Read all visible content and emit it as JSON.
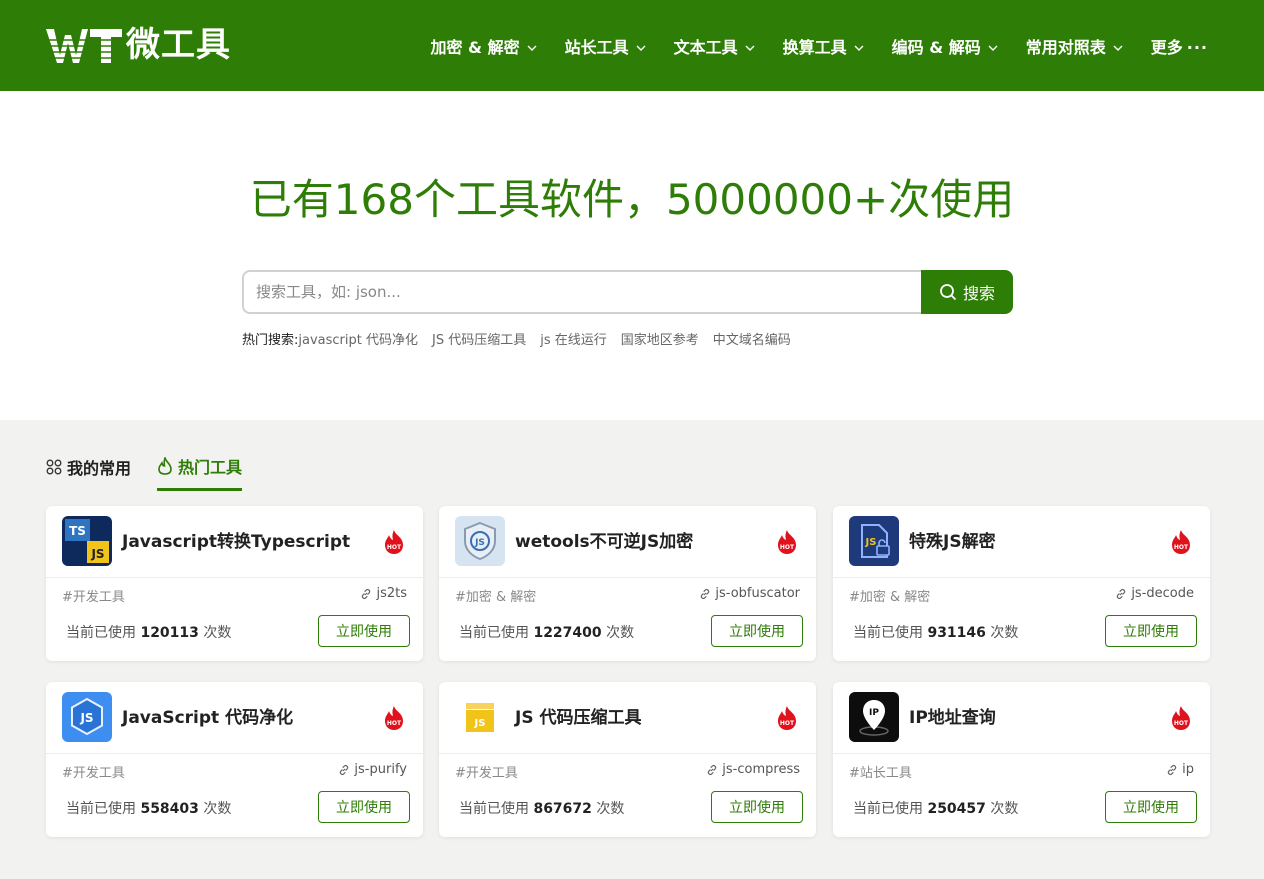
{
  "header": {
    "logo_text": "微工具",
    "nav": [
      {
        "label": "加密 & 解密",
        "has_chevron": true
      },
      {
        "label": "站长工具",
        "has_chevron": true
      },
      {
        "label": "文本工具",
        "has_chevron": true
      },
      {
        "label": "换算工具",
        "has_chevron": true
      },
      {
        "label": "编码 & 解码",
        "has_chevron": true
      },
      {
        "label": "常用对照表",
        "has_chevron": true
      }
    ],
    "more_label": "更多",
    "more_dots": "···"
  },
  "hero": {
    "title": "已有168个工具软件，5000000+次使用",
    "search_placeholder": "搜索工具，如: json...",
    "search_button": "搜索",
    "hot_label": "热门搜索:",
    "hot_keywords": [
      "javascript 代码净化",
      "JS 代码压缩工具",
      "js 在线运行",
      "国家地区参考",
      "中文域名编码"
    ]
  },
  "tabs": {
    "mine": "我的常用",
    "hot": "热门工具"
  },
  "card_common": {
    "count_prefix": "当前已使用",
    "count_suffix": "次数",
    "use_button": "立即使用"
  },
  "cards": [
    {
      "title": "Javascript转换Typescript",
      "category": "#开发工具",
      "slug": "js2ts",
      "count": "120113",
      "icon": "ts-js-icon"
    },
    {
      "title": "wetools不可逆JS加密",
      "category": "#加密 & 解密",
      "slug": "js-obfuscator",
      "count": "1227400",
      "icon": "js-shield-icon"
    },
    {
      "title": "特殊JS解密",
      "category": "#加密 & 解密",
      "slug": "js-decode",
      "count": "931146",
      "icon": "js-unlock-icon"
    },
    {
      "title": "JavaScript 代码净化",
      "category": "#开发工具",
      "slug": "js-purify",
      "count": "558403",
      "icon": "js-hexagon-icon"
    },
    {
      "title": "JS 代码压缩工具",
      "category": "#开发工具",
      "slug": "js-compress",
      "count": "867672",
      "icon": "js-box-icon"
    },
    {
      "title": "IP地址查询",
      "category": "#站长工具",
      "slug": "ip",
      "count": "250457",
      "icon": "ip-pin-icon"
    }
  ],
  "colors": {
    "brand": "#2e7d06",
    "hot": "#e0121b"
  }
}
